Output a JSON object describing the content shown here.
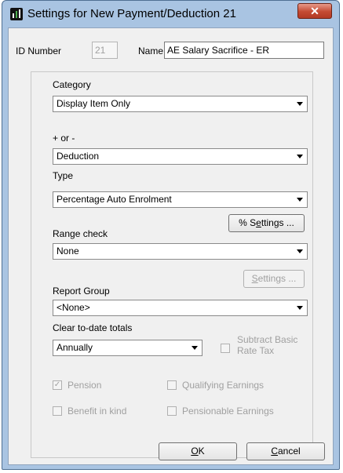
{
  "window": {
    "title": "Settings for New Payment/Deduction  21",
    "close_glyph": "✕"
  },
  "id_number": {
    "label": "ID Number",
    "value": "21"
  },
  "name": {
    "label": "Name",
    "value": "AE Salary Sacrifice - ER"
  },
  "category": {
    "label": "Category",
    "value": "Display Item Only"
  },
  "sign": {
    "label": "+ or -",
    "value": "Deduction"
  },
  "type": {
    "label": "Type",
    "value": "Percentage Auto Enrolment"
  },
  "pct_settings_button": {
    "prefix": "% S",
    "underline": "e",
    "suffix": "ttings ..."
  },
  "range_check": {
    "label": "Range check",
    "value": "None"
  },
  "settings_button": {
    "underline": "S",
    "suffix": "ettings ..."
  },
  "report_group": {
    "label": "Report Group",
    "value": "<None>"
  },
  "clear_totals": {
    "label": "Clear to-date totals",
    "value": "Annually"
  },
  "subtract_basic_rate_tax": {
    "line1": "Subtract Basic",
    "line2": "Rate Tax",
    "checked": false
  },
  "pension": {
    "label": "Pension",
    "checked": true,
    "check_glyph": "✓"
  },
  "qualifying_earnings": {
    "label": "Qualifying Earnings",
    "checked": false
  },
  "benefit_in_kind": {
    "label": "Benefit in kind",
    "checked": false
  },
  "pensionable_earnings": {
    "label": "Pensionable Earnings",
    "checked": false
  },
  "ok_button": {
    "underline": "O",
    "suffix": "K"
  },
  "cancel_button": {
    "underline": "C",
    "suffix": "ancel"
  }
}
